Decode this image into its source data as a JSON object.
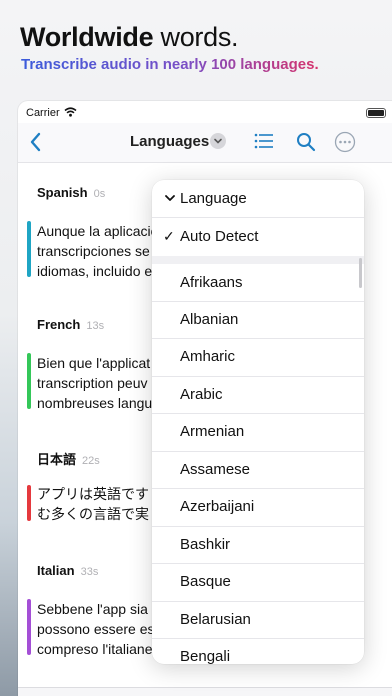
{
  "promo": {
    "headline_bold": "Worldwide",
    "headline_rest": " words.",
    "subhead": "Transcribe audio in nearly 100 languages."
  },
  "status": {
    "carrier": "Carrier"
  },
  "nav": {
    "title": "Languages",
    "icons": [
      "back-chevron-icon",
      "chevron-down-icon",
      "list-icon",
      "search-icon",
      "more-icon"
    ],
    "accent": "#1f7fc3"
  },
  "transcript": [
    {
      "lang": "Spanish",
      "time": "0s",
      "color": "#1fa5c4",
      "text": "Aunque la aplicacion\ntranscripciones se\nidiomas, incluido e"
    },
    {
      "lang": "French",
      "time": "13s",
      "color": "#34c759",
      "text": "Bien que l'applicat\ntranscription peuv\nnombreuses langu"
    },
    {
      "lang": "日本語",
      "time": "22s",
      "color": "#e5393e",
      "text": "アプリは英語です\nむ多くの言語で実"
    },
    {
      "lang": "Italian",
      "time": "33s",
      "color": "#a44fd6",
      "text": "Sebbene l'app sia\npossono essere es\ncompreso l'italiane"
    }
  ],
  "dropdown": {
    "header": "Language",
    "selected": "Auto Detect",
    "options": [
      "Afrikaans",
      "Albanian",
      "Amharic",
      "Arabic",
      "Armenian",
      "Assamese",
      "Azerbaijani",
      "Bashkir",
      "Basque",
      "Belarusian",
      "Bengali"
    ]
  }
}
